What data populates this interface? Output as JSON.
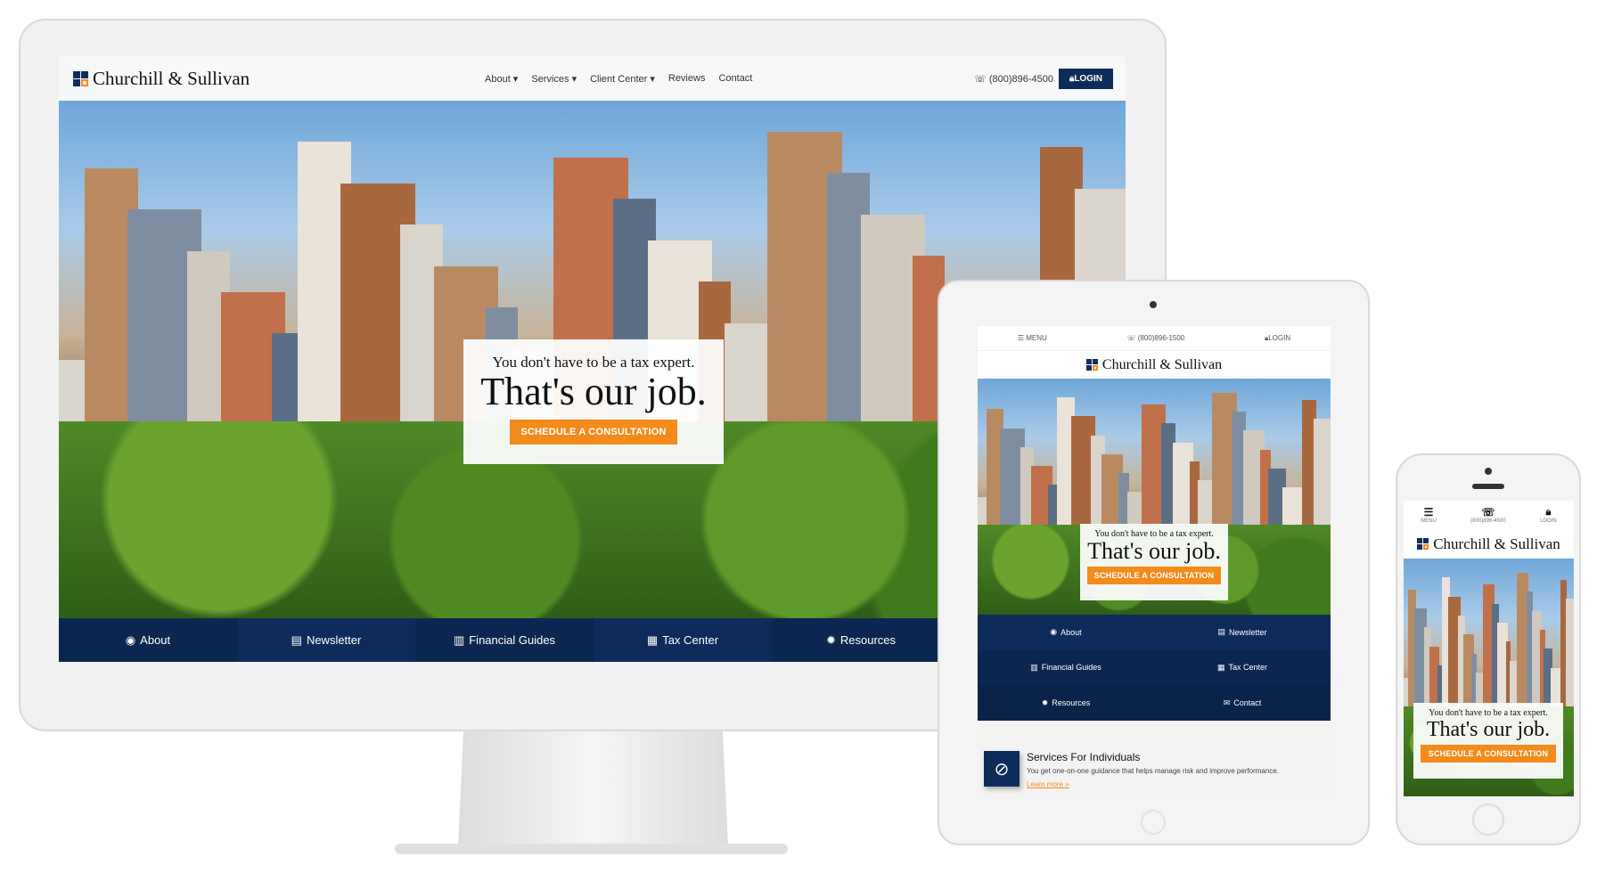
{
  "brand": {
    "name": "Churchill & Sullivan",
    "navy": "#0d2c5a",
    "orange": "#f28b1c"
  },
  "desktop": {
    "nav": [
      {
        "label": "About",
        "has_dropdown": true
      },
      {
        "label": "Services",
        "has_dropdown": true
      },
      {
        "label": "Client Center",
        "has_dropdown": true
      },
      {
        "label": "Reviews"
      },
      {
        "label": "Contact"
      }
    ],
    "phone": "(800)896-4500",
    "login": "LOGIN",
    "hero": {
      "tagline": "You don't have to be a tax expert.",
      "headline": "That's our job.",
      "cta": "SCHEDULE A CONSULTATION"
    },
    "bottom_nav": [
      {
        "label": "About",
        "icon": "user-circle-icon",
        "glyph": "◉"
      },
      {
        "label": "Newsletter",
        "icon": "newspaper-icon",
        "glyph": "▤"
      },
      {
        "label": "Financial Guides",
        "icon": "bar-chart-icon",
        "glyph": "▥"
      },
      {
        "label": "Tax Center",
        "icon": "calendar-icon",
        "glyph": "▦"
      },
      {
        "label": "Resources",
        "icon": "gear-icon",
        "glyph": "✹"
      }
    ]
  },
  "tablet": {
    "menu": "MENU",
    "phone": "(800)896-1500",
    "login": "LOGIN",
    "hero": {
      "tagline": "You don't have to be a tax expert.",
      "headline": "That's our job.",
      "cta": "SCHEDULE A CONSULTATION"
    },
    "nav": [
      {
        "label": "About",
        "glyph": "◉"
      },
      {
        "label": "Newsletter",
        "glyph": "▤"
      },
      {
        "label": "Financial Guides",
        "glyph": "▥"
      },
      {
        "label": "Tax Center",
        "glyph": "▦"
      },
      {
        "label": "Resources",
        "glyph": "✹"
      },
      {
        "label": "Contact",
        "glyph": "✉"
      }
    ],
    "service": {
      "title": "Services For Individuals",
      "text": "You get one-on-one guidance that helps manage risk and improve performance.",
      "link": "Learn more »"
    }
  },
  "phone": {
    "menu": "MENU",
    "phone": "(800)896-4500",
    "login": "LOGIN",
    "hero": {
      "tagline": "You don't have to be a tax expert.",
      "headline": "That's our job.",
      "cta": "SCHEDULE A CONSULTATION"
    }
  }
}
